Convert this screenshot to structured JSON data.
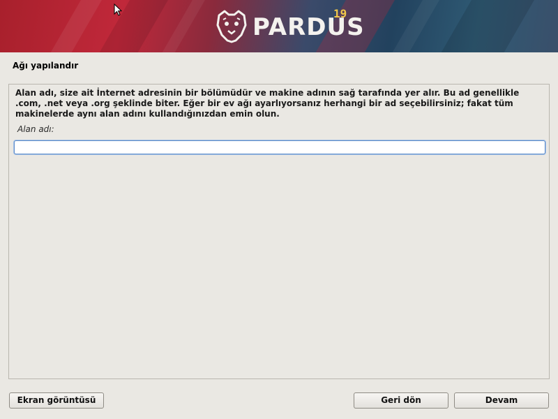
{
  "header": {
    "logo_text": "PARDUS",
    "logo_version": "19"
  },
  "page": {
    "title": "Ağı yapılandır"
  },
  "panel": {
    "description": "Alan adı, size ait İnternet adresinin bir bölümüdür ve makine adının sağ tarafında yer alır.  Bu ad genellikle .com, .net veya .org şeklinde biter.  Eğer bir ev ağı ayarlıyorsanız herhangi bir ad seçebilirsiniz; fakat tüm makinelerde aynı alan adını kullandığınızdan emin olun.",
    "field_label": "Alan adı:",
    "field_value": ""
  },
  "buttons": {
    "screenshot": "Ekran görüntüsü",
    "back": "Geri dön",
    "continue": "Devam"
  },
  "colors": {
    "banner_red": "#c0283a",
    "banner_blue": "#22425e",
    "version_yellow": "#f2c84a",
    "focus_blue": "#5a8ac8",
    "background": "#eae8e3"
  },
  "icons": {
    "logo": "pardus-leopard-icon",
    "cursor": "mouse-pointer-icon"
  }
}
